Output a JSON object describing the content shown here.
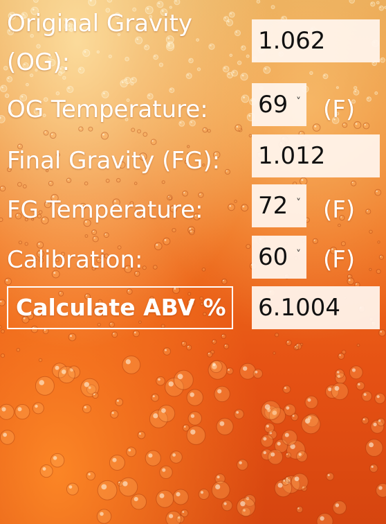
{
  "fields": {
    "og": {
      "label_line1": "Original Gravity",
      "label_line2": "(OG):",
      "value": "1.062"
    },
    "og_temp": {
      "label": "OG Temperature:",
      "value": "69",
      "unit": "(F)"
    },
    "fg": {
      "label": "Final Gravity (FG):",
      "value": "1.012"
    },
    "fg_temp": {
      "label": "FG Temperature:",
      "value": "72",
      "unit": "(F)"
    },
    "calibration": {
      "label": "Calibration:",
      "value": "60",
      "unit": "(F)"
    }
  },
  "calculate": {
    "label": "Calculate ABV %",
    "result": "6.1004"
  },
  "icons": {
    "dropdown": "chevron-down-icon"
  },
  "colors": {
    "field_bg": "#fff4ec",
    "text": "#ffffff",
    "field_text": "#111111"
  }
}
